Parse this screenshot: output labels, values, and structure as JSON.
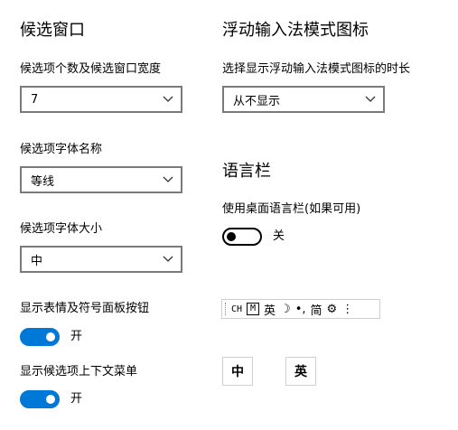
{
  "candidate_window": {
    "heading": "候选窗口",
    "count_width": {
      "label": "候选项个数及候选窗口宽度",
      "value": "7"
    },
    "font_name": {
      "label": "候选项字体名称",
      "value": "等线"
    },
    "font_size": {
      "label": "候选项字体大小",
      "value": "中"
    },
    "emoji_panel": {
      "label": "显示表情及符号面板按钮",
      "state": "开",
      "on": true
    },
    "context_menu": {
      "label": "显示候选项上下文菜单",
      "state": "开",
      "on": true
    }
  },
  "floating_ime": {
    "heading": "浮动输入法模式图标",
    "duration": {
      "label": "选择显示浮动输入法模式图标的时长",
      "value": "从不显示"
    }
  },
  "language_bar": {
    "heading": "语言栏",
    "use_desktop": {
      "label": "使用桌面语言栏(如果可用)",
      "state": "关",
      "on": false
    },
    "bar_items": {
      "ch": "CH",
      "m": "M",
      "lang": "英",
      "moon": "☽",
      "punct": "•,",
      "simp": "简",
      "gear": "⚙",
      "more": "⋮"
    },
    "samples": {
      "zh": "中",
      "en": "英"
    }
  },
  "colors": {
    "accent": "#0078d7",
    "border": "#7a7a7a"
  }
}
